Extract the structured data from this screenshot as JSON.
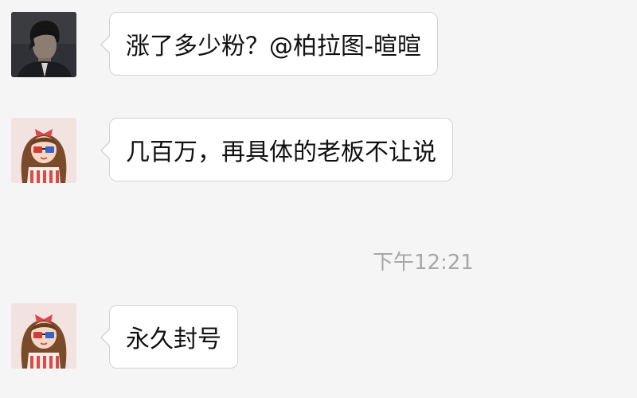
{
  "messages": [
    {
      "sender": "male-avatar",
      "text": "涨了多少粉？@柏拉图-暄暄"
    },
    {
      "sender": "cartoon-girl-avatar",
      "text": "几百万，再具体的老板不让说"
    },
    {
      "sender": "cartoon-girl-avatar",
      "text": "永久封号"
    }
  ],
  "timestamp": "下午12:21",
  "colors": {
    "background": "#f5f5f5",
    "bubble_fill": "#ffffff",
    "bubble_border": "#d3d3d3",
    "message_text": "#111111",
    "timestamp_text": "#a7a7a7"
  }
}
